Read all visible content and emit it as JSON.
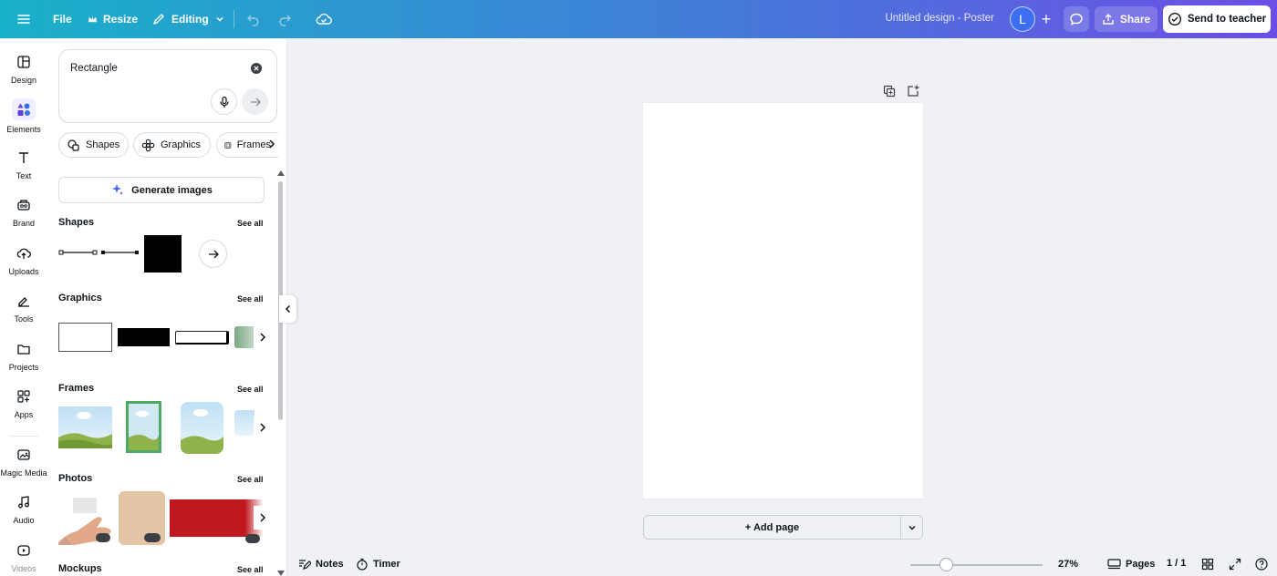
{
  "topbar": {
    "file": "File",
    "resize": "Resize",
    "editing": "Editing",
    "title": "Untitled design - Poster",
    "avatar_letter": "L",
    "share": "Share",
    "send_to_teacher": "Send to teacher",
    "gradient_start": "#19b1c9",
    "gradient_end": "#6c4ee6"
  },
  "rail": {
    "items": [
      {
        "label": "Design",
        "icon": "layout-icon"
      },
      {
        "label": "Elements",
        "icon": "shapes-icon"
      },
      {
        "label": "Text",
        "icon": "text-icon"
      },
      {
        "label": "Brand",
        "icon": "brand-icon"
      },
      {
        "label": "Uploads",
        "icon": "cloud-upload-icon"
      },
      {
        "label": "Tools",
        "icon": "pen-icon"
      },
      {
        "label": "Projects",
        "icon": "folder-icon"
      },
      {
        "label": "Apps",
        "icon": "apps-icon"
      },
      {
        "label": "Magic Media",
        "icon": "magic-media-icon"
      },
      {
        "label": "Audio",
        "icon": "music-icon"
      },
      {
        "label": "Videos",
        "icon": "video-icon"
      }
    ],
    "active": "Elements"
  },
  "panel": {
    "search_value": "Rectangle",
    "chips": [
      "Shapes",
      "Graphics",
      "Frames"
    ],
    "generate_images": "Generate images",
    "sections": {
      "shapes": "Shapes",
      "graphics": "Graphics",
      "frames": "Frames",
      "photos": "Photos",
      "mockups": "Mockups"
    },
    "see_all": "See all"
  },
  "canvas": {
    "add_page": "+ Add page"
  },
  "bottombar": {
    "notes": "Notes",
    "timer": "Timer",
    "zoom": "27%",
    "zoom_level": 0.27,
    "pages": "Pages",
    "page_count": "1 / 1"
  }
}
